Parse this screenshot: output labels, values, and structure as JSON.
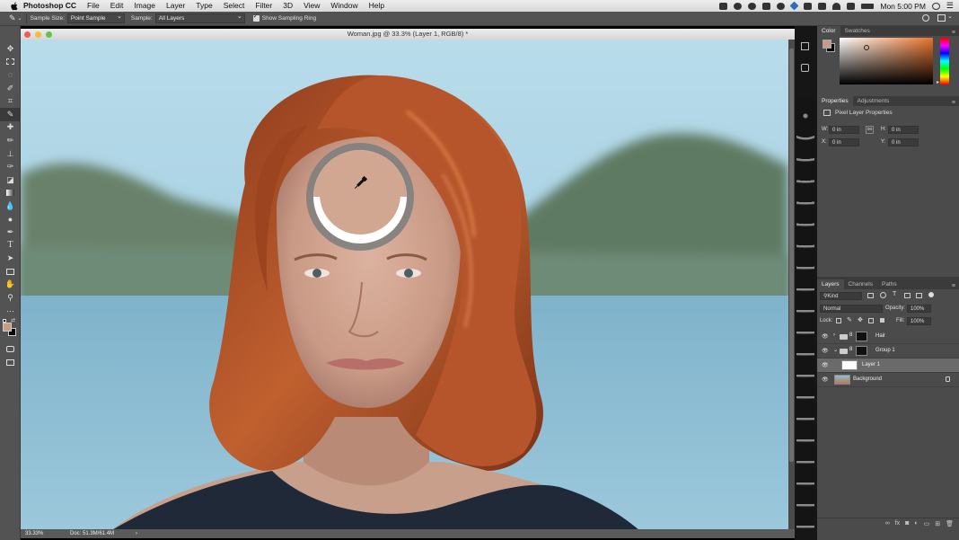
{
  "menubar": {
    "app_name": "Photoshop CC",
    "items": [
      "File",
      "Edit",
      "Image",
      "Layer",
      "Type",
      "Select",
      "Filter",
      "3D",
      "View",
      "Window",
      "Help"
    ],
    "clock": "Mon 5:00 PM"
  },
  "options": {
    "sample_size_label": "Sample Size:",
    "sample_size_value": "Point Sample",
    "sample_label": "Sample:",
    "sample_value": "All Layers",
    "sampling_ring_label": "Show Sampling Ring",
    "sampling_ring_checked": true
  },
  "document": {
    "title": "Woman.jpg @ 33.3% (Layer 1, RGB/8) *",
    "zoom": "33.33%",
    "doc_size": "Doc: 51.3M/61.4M"
  },
  "colors": {
    "sampled": "#d1a792",
    "foreground": "#c99a85",
    "background": "#000000",
    "ui_dark": "#535353",
    "hair": "#b7542a"
  },
  "color_panel": {
    "tabs": [
      "Color",
      "Swatches"
    ]
  },
  "properties_panel": {
    "tabs": [
      "Properties",
      "Adjustments"
    ],
    "heading": "Pixel Layer Properties",
    "w_label": "W:",
    "w_value": "0 in",
    "h_label": "H:",
    "h_value": "0 in",
    "x_label": "X:",
    "x_value": "0 in",
    "y_label": "Y:",
    "y_value": "0 in"
  },
  "layers_panel": {
    "tabs": [
      "Layers",
      "Channels",
      "Paths"
    ],
    "filter_kind": "Kind",
    "blend_mode": "Normal",
    "opacity_label": "Opacity:",
    "opacity_value": "100%",
    "lock_label": "Lock:",
    "fill_label": "Fill:",
    "fill_value": "100%",
    "layers": [
      {
        "name": "Hair",
        "type": "group"
      },
      {
        "name": "Group 1",
        "type": "group"
      },
      {
        "name": "Layer 1",
        "type": "pixel",
        "selected": true
      },
      {
        "name": "Background",
        "type": "image",
        "locked": true
      }
    ]
  },
  "tools": [
    "move",
    "marquee",
    "lasso",
    "quick-selection",
    "crop",
    "eyedropper",
    "healing-brush",
    "brush",
    "clone-stamp",
    "history-brush",
    "eraser",
    "gradient",
    "blur",
    "dodge",
    "pen",
    "type",
    "path-selection",
    "rectangle",
    "hand",
    "zoom",
    "more"
  ]
}
